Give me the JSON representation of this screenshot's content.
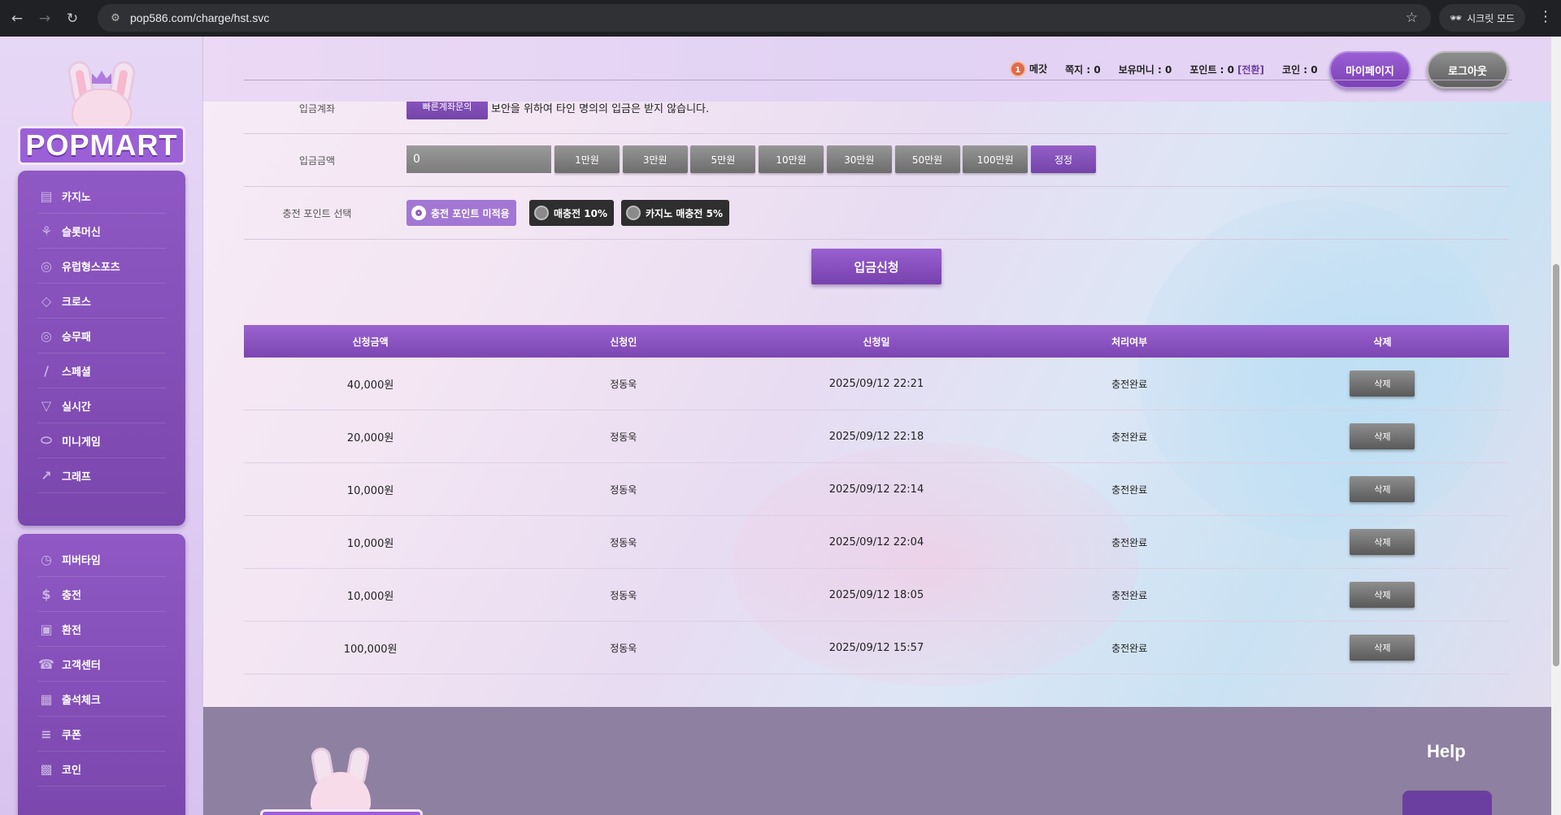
{
  "browser": {
    "url": "pop586.com/charge/hst.svc",
    "incognito_label": "시크릿 모드"
  },
  "logo": {
    "text": "POPMART"
  },
  "sidebar": {
    "group1": [
      {
        "label": "카지노",
        "icon": "cards-icon"
      },
      {
        "label": "슬롯머신",
        "icon": "slot-icon"
      },
      {
        "label": "유럽형스포츠",
        "icon": "ball-icon"
      },
      {
        "label": "크로스",
        "icon": "football-icon"
      },
      {
        "label": "승무패",
        "icon": "soccer-icon"
      },
      {
        "label": "스페셜",
        "icon": "bat-icon"
      },
      {
        "label": "실시간",
        "icon": "basket-icon"
      },
      {
        "label": "미니게임",
        "icon": "gamepad-icon"
      },
      {
        "label": "그래프",
        "icon": "chart-icon"
      }
    ],
    "group2": [
      {
        "label": "피버타임",
        "icon": "clock-icon"
      },
      {
        "label": "충전",
        "icon": "dollar-icon"
      },
      {
        "label": "환전",
        "icon": "wallet-icon"
      },
      {
        "label": "고객센터",
        "icon": "support-icon"
      },
      {
        "label": "출석체크",
        "icon": "calendar-icon"
      },
      {
        "label": "쿠폰",
        "icon": "coupon-icon"
      },
      {
        "label": "코인",
        "icon": "coin-icon"
      }
    ]
  },
  "header": {
    "level_badge": "1",
    "nickname": "메갓",
    "message": "쪽지 : 0",
    "money": "보유머니 : 0",
    "point": "포인트 : 0",
    "convert": "[전환]",
    "coin": "코인 : 0",
    "mypage_label": "마이페이지",
    "logout_label": "로그아웃"
  },
  "form": {
    "account_label": "입금계좌",
    "quick_inquiry": "빠른계좌문의",
    "notice": "보안을 위하여 타인 명의의 입금은 받지 않습니다.",
    "amount_label": "입금금액",
    "amount_value": "0",
    "amount_buttons": [
      "1만원",
      "3만원",
      "5만원",
      "10만원",
      "30만원",
      "50만원",
      "100만원"
    ],
    "reset_label": "정정",
    "point_label": "충전 포인트 선택",
    "point_options": [
      "충전 포인트 미적용",
      "매충전 10%",
      "카지노 매충전 5%"
    ],
    "submit_label": "입금신청"
  },
  "table": {
    "headers": [
      "신청금액",
      "신청인",
      "신청일",
      "처리여부",
      "삭제"
    ],
    "rows": [
      {
        "amount": "40,000원",
        "name": "정동욱",
        "date": "2025/09/12 22:21",
        "status": "충전완료",
        "delete": "삭제"
      },
      {
        "amount": "20,000원",
        "name": "정동욱",
        "date": "2025/09/12 22:18",
        "status": "충전완료",
        "delete": "삭제"
      },
      {
        "amount": "10,000원",
        "name": "정동욱",
        "date": "2025/09/12 22:14",
        "status": "충전완료",
        "delete": "삭제"
      },
      {
        "amount": "10,000원",
        "name": "정동욱",
        "date": "2025/09/12 22:04",
        "status": "충전완료",
        "delete": "삭제"
      },
      {
        "amount": "10,000원",
        "name": "정동욱",
        "date": "2025/09/12 18:05",
        "status": "충전완료",
        "delete": "삭제"
      },
      {
        "amount": "100,000원",
        "name": "정동욱",
        "date": "2025/09/12 15:57",
        "status": "충전완료",
        "delete": "삭제"
      }
    ]
  },
  "footer": {
    "help_title": "Help"
  }
}
